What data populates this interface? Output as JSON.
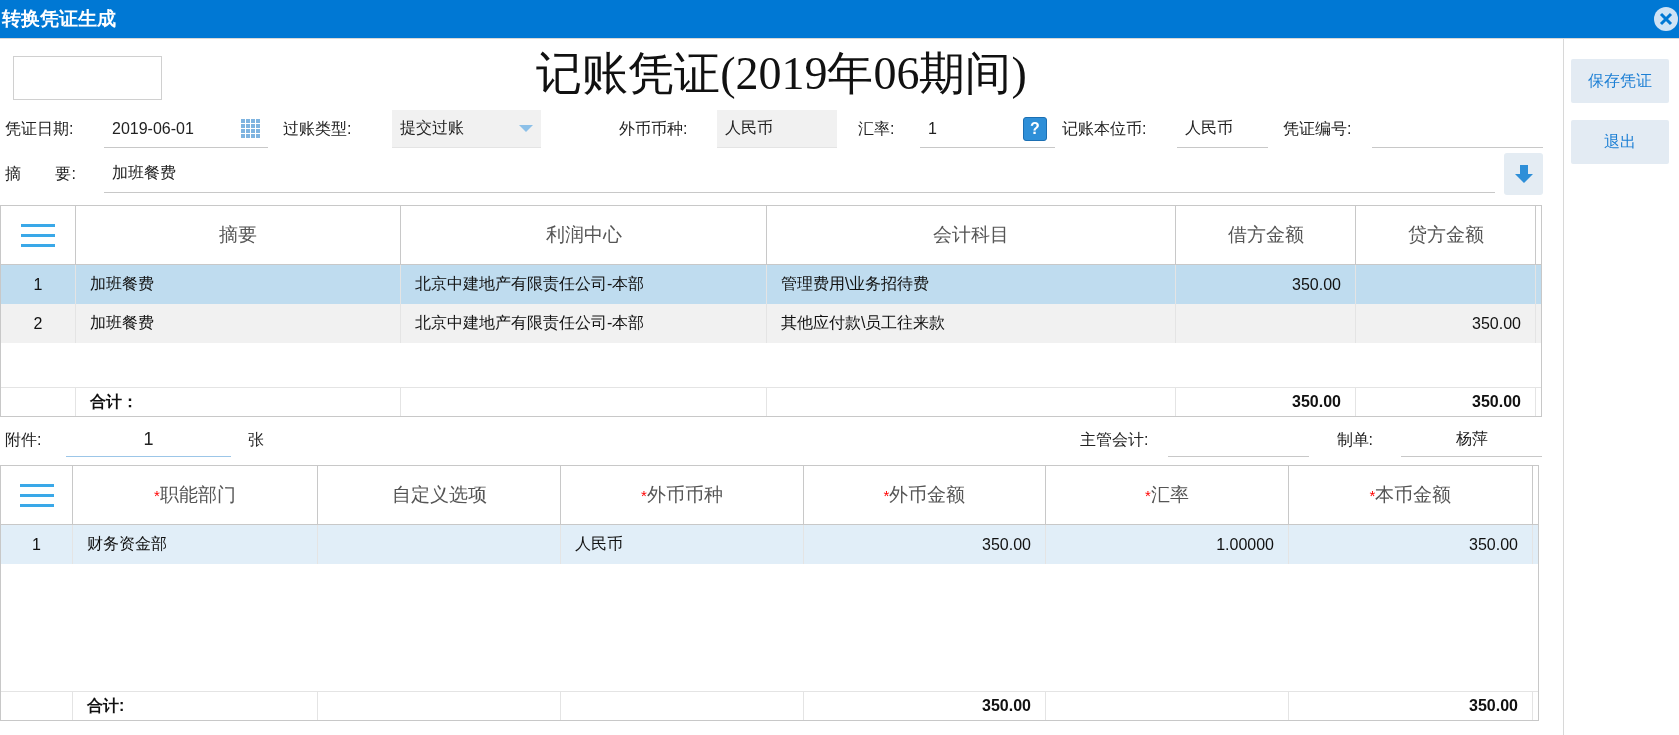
{
  "window": {
    "title": "转换凭证生成"
  },
  "voucher": {
    "heading": "记账凭证(2019年06期间)",
    "header_fields": [
      {
        "label": "凭证日期:",
        "value": "2019-06-01",
        "kind": "date"
      },
      {
        "label": "过账类型:",
        "value": "提交过账",
        "kind": "dropdown"
      },
      {
        "label": "外币币种:",
        "value": "人民币",
        "kind": "readonly"
      },
      {
        "label": "汇率:",
        "value": "1",
        "kind": "help",
        "icon_text": "?"
      },
      {
        "label": "记账本位币:",
        "value": "人民币",
        "kind": "text"
      },
      {
        "label": "凭证编号:",
        "kind": "text"
      }
    ],
    "summary": {
      "label": "摘 要:",
      "value": "加班餐费"
    },
    "entries_table": {
      "columns": [
        {
          "kind": "menu"
        },
        {
          "label": "摘要",
          "kind": "text"
        },
        {
          "label": "利润中心",
          "kind": "text"
        },
        {
          "label": "会计科目",
          "kind": "text"
        },
        {
          "label": "借方金额",
          "kind": "amount"
        },
        {
          "label": "贷方金额",
          "kind": "amount"
        }
      ],
      "rows": [
        {
          "selected": true,
          "no": "1",
          "summary": "加班餐费",
          "profit_center": "北京中建地产有限责任公司-本部",
          "account": "管理费用\\业务招待费",
          "debit": "350.00"
        },
        {
          "selected": false,
          "no": "2",
          "summary": "加班餐费",
          "profit_center": "北京中建地产有限责任公司-本部",
          "account": "其他应付款\\员工往来款",
          "credit": "350.00"
        }
      ],
      "total": {
        "label": "合计：",
        "debit": "350.00",
        "credit": "350.00"
      }
    },
    "attachments": {
      "label": "附件:",
      "value": "1",
      "unit": "张"
    },
    "supervisor": {
      "label": "主管会计:"
    },
    "preparer": {
      "label": "制单:",
      "value": "杨萍"
    },
    "allocation_table": {
      "columns": [
        {
          "kind": "menu"
        },
        {
          "label": "职能部门",
          "required_mark": "*",
          "kind": "text"
        },
        {
          "label": "自定义选项",
          "kind": "text"
        },
        {
          "label": "外币币种",
          "required_mark": "*",
          "kind": "text"
        },
        {
          "label": "外币金额",
          "required_mark": "*",
          "kind": "amount"
        },
        {
          "label": "汇率",
          "required_mark": "*",
          "kind": "amount"
        },
        {
          "label": "本币金额",
          "required_mark": "*",
          "kind": "amount"
        }
      ],
      "rows": [
        {
          "selected": true,
          "no": "1",
          "department": "财务资金部",
          "currency": "人民币",
          "fc_amount": "350.00",
          "rate": "1.00000",
          "amount": "350.00"
        }
      ],
      "total": {
        "label": "合计:",
        "fc_amount": "350.00",
        "amount": "350.00"
      }
    }
  },
  "actions": [
    {
      "label": "保存凭证"
    },
    {
      "label": "退出"
    }
  ]
}
